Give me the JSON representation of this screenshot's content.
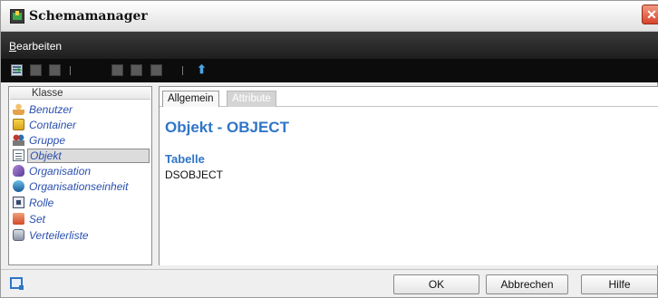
{
  "window": {
    "title": "Schemamanager",
    "close_glyph": "✕"
  },
  "menubar": {
    "items": [
      {
        "label": "Bearbeiten",
        "mnemonic": "B",
        "rest": "earbeiten"
      }
    ]
  },
  "toolbar": {
    "buttons": [
      "add-schema-icon",
      "toolbar-icon-2",
      "toolbar-icon-3",
      "toolbar-icon-4",
      "toolbar-icon-5",
      "toolbar-icon-6"
    ],
    "arrow_glyph": "⬆"
  },
  "tree": {
    "header": "Klasse",
    "selected": "Objekt",
    "items": [
      {
        "label": "Benutzer",
        "icon": "user-icon"
      },
      {
        "label": "Container",
        "icon": "container-icon"
      },
      {
        "label": "Gruppe",
        "icon": "group-icon"
      },
      {
        "label": "Objekt",
        "icon": "object-icon"
      },
      {
        "label": "Organisation",
        "icon": "organization-icon"
      },
      {
        "label": "Organisationseinheit",
        "icon": "organization-unit-icon"
      },
      {
        "label": "Rolle",
        "icon": "role-icon"
      },
      {
        "label": "Set",
        "icon": "set-icon"
      },
      {
        "label": "Verteilerliste",
        "icon": "distribution-list-icon"
      }
    ]
  },
  "tabs": [
    {
      "label": "Allgemein",
      "active": true
    },
    {
      "label": "Attribute",
      "active": false
    }
  ],
  "detail": {
    "title": "Objekt - OBJECT",
    "section_title": "Tabelle",
    "section_value": "DSOBJECT"
  },
  "buttons": {
    "ok": "OK",
    "cancel": "Abbrechen",
    "help": "Hilfe"
  },
  "colors": {
    "accent": "#2f75c7",
    "tree_text": "#2a4fb0",
    "close": "#d8432a"
  }
}
